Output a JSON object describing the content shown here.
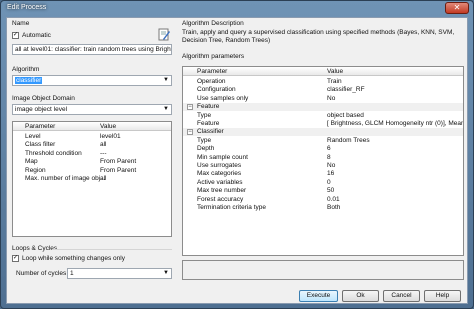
{
  "window": {
    "title": "Edit Process",
    "close": "✕"
  },
  "left": {
    "name_label": "Name",
    "automatic_label": "Automatic",
    "automatic_checked": true,
    "name_value": "all at  level01: classifier: train random trees using Brightness,",
    "algorithm_label": "Algorithm",
    "algorithm_value": "classifier",
    "domain_label": "Image Object Domain",
    "domain_value": "image object level",
    "params_headers": [
      "Parameter",
      "Value"
    ],
    "params_rows": [
      [
        "Level",
        "level01"
      ],
      [
        "Class filter",
        "all"
      ],
      [
        "Threshold condition",
        "---"
      ],
      [
        "Map",
        "From Parent"
      ],
      [
        "Region",
        "From Parent"
      ],
      [
        "Max. number of image obj...",
        "all"
      ]
    ],
    "loops_label": "Loops & Cycles",
    "loop_change_label": "Loop while something changes only",
    "loop_change_checked": true,
    "cycles_label": "Number of cycles",
    "cycles_value": "1"
  },
  "right": {
    "desc_label": "Algorithm Description",
    "desc_text": "Train, apply and query a supervised classification using specified methods (Bayes, KNN, SVM, Decision Tree, Random Trees)",
    "params_label": "Algorithm parameters",
    "params_headers": [
      "Parameter",
      "Value"
    ],
    "top_rows": [
      [
        "Operation",
        "Train"
      ],
      [
        "Configuration",
        "classifier_RF"
      ],
      [
        "Use samples only",
        "No"
      ]
    ],
    "feature_category": "Feature",
    "feature_rows": [
      [
        "Type",
        "object based"
      ],
      [
        "Feature",
        "[ Brightness, GLCM Homogeneity ntr (0)], Mean _te..."
      ]
    ],
    "classifier_category": "Classifier",
    "classifier_rows": [
      [
        "Type",
        "Random Trees"
      ],
      [
        "Depth",
        "6"
      ],
      [
        "Min sample count",
        "8"
      ],
      [
        "Use surrogates",
        "No"
      ],
      [
        "Max categories",
        "16"
      ],
      [
        "Active variables",
        "0"
      ],
      [
        "Max tree number",
        "50"
      ],
      [
        "Forest accuracy",
        "0.01"
      ],
      [
        "Termination criteria type",
        "Both"
      ]
    ]
  },
  "buttons": {
    "execute": "Execute",
    "ok": "Ok",
    "cancel": "Cancel",
    "help": "Help"
  }
}
